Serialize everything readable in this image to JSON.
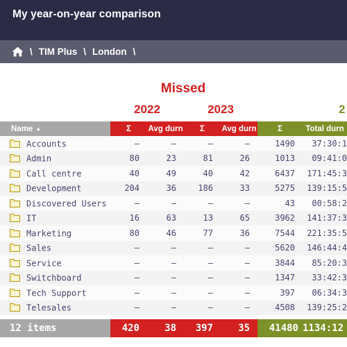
{
  "window": {
    "title": "My year-on-year comparison"
  },
  "breadcrumb": {
    "home_icon": "home-icon",
    "separator": "\\",
    "items": [
      {
        "label": "TIM Plus"
      },
      {
        "label": "London"
      }
    ]
  },
  "group_headers": {
    "metric": "Missed",
    "year_2022": "2022",
    "year_2023": "2023",
    "year_2024": "2"
  },
  "table": {
    "columns": [
      {
        "key": "name",
        "label": "Name",
        "sort": "▲",
        "style": "name"
      },
      {
        "key": "sum22",
        "label": "Σ",
        "style": "red"
      },
      {
        "key": "avg22",
        "label": "Avg durn",
        "style": "red"
      },
      {
        "key": "sum23",
        "label": "Σ",
        "style": "red"
      },
      {
        "key": "avg23",
        "label": "Avg durn",
        "style": "red"
      },
      {
        "key": "sum24",
        "label": "Σ",
        "style": "green"
      },
      {
        "key": "tot24",
        "label": "Total durn",
        "style": "green"
      }
    ],
    "rows": [
      {
        "icon": "folder-icon",
        "name": "Accounts",
        "sum22": "–",
        "avg22": "–",
        "sum23": "–",
        "avg23": "–",
        "sum24": "1490",
        "tot24": "37:30:1"
      },
      {
        "icon": "folder-icon",
        "name": "Admin",
        "sum22": "80",
        "avg22": "23",
        "sum23": "81",
        "avg23": "26",
        "sum24": "1013",
        "tot24": "09:41:0"
      },
      {
        "icon": "folder-icon",
        "name": "Call centre",
        "sum22": "40",
        "avg22": "49",
        "sum23": "40",
        "avg23": "42",
        "sum24": "6437",
        "tot24": "171:45:3"
      },
      {
        "icon": "folder-icon",
        "name": "Development",
        "sum22": "204",
        "avg22": "36",
        "sum23": "186",
        "avg23": "33",
        "sum24": "5275",
        "tot24": "139:15:5"
      },
      {
        "icon": "folder-icon",
        "name": "Discovered Users",
        "sum22": "–",
        "avg22": "–",
        "sum23": "–",
        "avg23": "–",
        "sum24": "43",
        "tot24": "00:58:2"
      },
      {
        "icon": "folder-icon",
        "name": "IT",
        "sum22": "16",
        "avg22": "63",
        "sum23": "13",
        "avg23": "65",
        "sum24": "3962",
        "tot24": "141:37:3"
      },
      {
        "icon": "folder-icon",
        "name": "Marketing",
        "sum22": "80",
        "avg22": "46",
        "sum23": "77",
        "avg23": "36",
        "sum24": "7544",
        "tot24": "221:35:5"
      },
      {
        "icon": "folder-icon",
        "name": "Sales",
        "sum22": "–",
        "avg22": "–",
        "sum23": "–",
        "avg23": "–",
        "sum24": "5620",
        "tot24": "146:44:4"
      },
      {
        "icon": "folder-icon",
        "name": "Service",
        "sum22": "–",
        "avg22": "–",
        "sum23": "–",
        "avg23": "–",
        "sum24": "3844",
        "tot24": "85:20:3"
      },
      {
        "icon": "folder-icon",
        "name": "Switchboard",
        "sum22": "–",
        "avg22": "–",
        "sum23": "–",
        "avg23": "–",
        "sum24": "1347",
        "tot24": "33:42:3"
      },
      {
        "icon": "folder-icon",
        "name": "Tech Support",
        "sum22": "–",
        "avg22": "–",
        "sum23": "–",
        "avg23": "–",
        "sum24": "397",
        "tot24": "06:34:3"
      },
      {
        "icon": "folder-icon",
        "name": "Telesales",
        "sum22": "–",
        "avg22": "–",
        "sum23": "–",
        "avg23": "–",
        "sum24": "4508",
        "tot24": "139:25:2"
      }
    ],
    "footer": {
      "name": "12 items",
      "sum22": "420",
      "avg22": "38",
      "sum23": "397",
      "avg23": "35",
      "sum24": "41480",
      "tot24": "1134:12"
    }
  },
  "colors": {
    "title_bar": "#2b2b46",
    "breadcrumb_bar": "#5b5b6e",
    "missed_red": "#d32020",
    "total_green": "#7d9128",
    "name_header_grey": "#a8a8a8",
    "row_text": "#4b4470"
  }
}
